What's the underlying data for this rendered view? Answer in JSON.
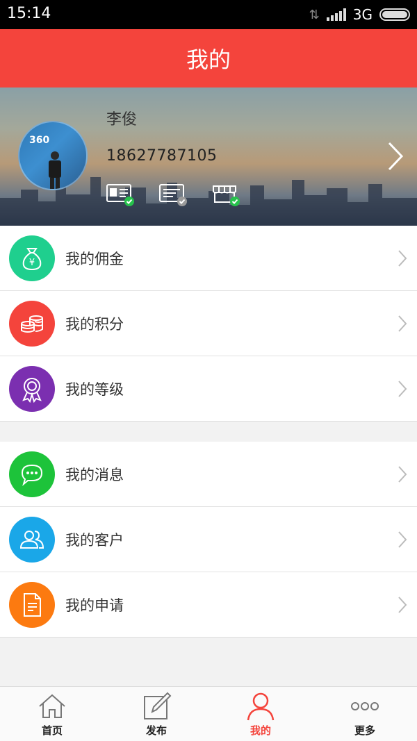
{
  "status_bar": {
    "time": "15:14",
    "network": "3G"
  },
  "header": {
    "title": "我的"
  },
  "profile": {
    "name": "李俊",
    "phone": "18627787105",
    "avatar_text": "360",
    "badges": [
      "id-card-verified-icon",
      "document-verified-icon",
      "shop-verified-icon"
    ]
  },
  "menu_groups": [
    [
      {
        "label": "我的佣金",
        "icon": "money-bag-icon",
        "color": "#1fcf8e"
      },
      {
        "label": "我的积分",
        "icon": "coins-icon",
        "color": "#f4443c"
      },
      {
        "label": "我的等级",
        "icon": "award-ribbon-icon",
        "color": "#7b2fb0"
      }
    ],
    [
      {
        "label": "我的消息",
        "icon": "chat-bubble-icon",
        "color": "#1dc33a"
      },
      {
        "label": "我的客户",
        "icon": "users-icon",
        "color": "#1aa7e8"
      },
      {
        "label": "我的申请",
        "icon": "document-icon",
        "color": "#fc7a10"
      }
    ]
  ],
  "tabbar": {
    "tabs": [
      {
        "label": "首页",
        "icon": "home-icon"
      },
      {
        "label": "发布",
        "icon": "edit-icon"
      },
      {
        "label": "我的",
        "icon": "user-icon",
        "active": true
      },
      {
        "label": "更多",
        "icon": "more-dots-icon"
      }
    ]
  },
  "colors": {
    "accent": "#f4443c"
  }
}
